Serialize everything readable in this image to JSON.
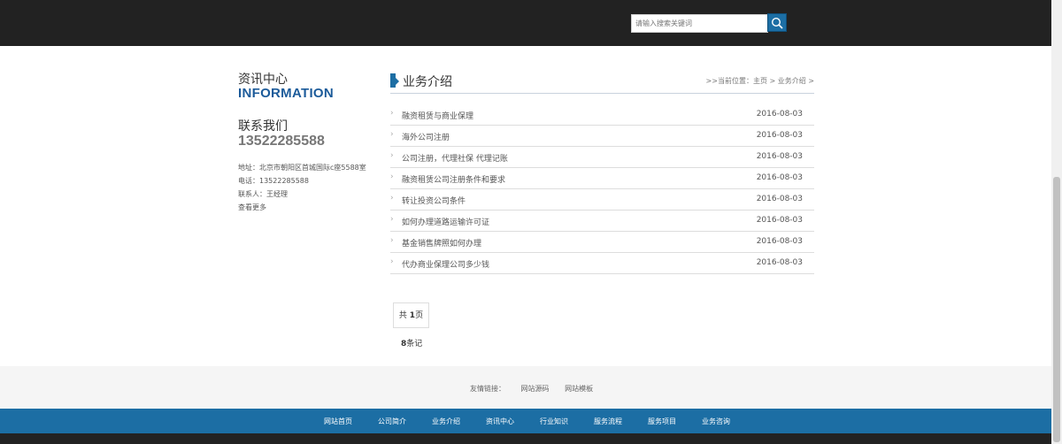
{
  "search": {
    "placeholder": "请输入搜索关键词",
    "icon": "search-icon"
  },
  "sidebar": {
    "title": "资讯中心",
    "subtitle": "INFORMATION",
    "contact_title": "联系我们",
    "phone_big": "13522285588",
    "address": "地址：北京市朝阳区首城国际c座5588室",
    "tel": "电话：13522285588",
    "contact_person": "联系人：王经理",
    "more": "查看更多"
  },
  "main": {
    "title": "业务介绍",
    "breadcrumb": ">>当前位置：主页 > 业务介绍 >",
    "items": [
      {
        "title": "融资租赁与商业保理",
        "date": "2016-08-03"
      },
      {
        "title": "海外公司注册",
        "date": "2016-08-03"
      },
      {
        "title": "公司注册，代理社保 代理记账",
        "date": "2016-08-03"
      },
      {
        "title": "融资租赁公司注册条件和要求",
        "date": "2016-08-03"
      },
      {
        "title": "转让投资公司条件",
        "date": "2016-08-03"
      },
      {
        "title": "如何办理道路运输许可证",
        "date": "2016-08-03"
      },
      {
        "title": "基金销售牌照如何办理",
        "date": "2016-08-03"
      },
      {
        "title": "代办商业保理公司多少钱",
        "date": "2016-08-03"
      }
    ]
  },
  "pager": {
    "prefix": "共 ",
    "pages": "1",
    "suffix": "页",
    "count": "8",
    "count_suffix": "条记"
  },
  "friend_links": {
    "label": "友情链接：",
    "links": [
      "网站源码",
      "网站模板"
    ]
  },
  "footer_nav": [
    "网站首页",
    "公司简介",
    "业务介绍",
    "资讯中心",
    "行业知识",
    "服务流程",
    "服务项目",
    "业务咨询"
  ],
  "colors": {
    "accent": "#1c6ea4",
    "dark": "#222222"
  }
}
